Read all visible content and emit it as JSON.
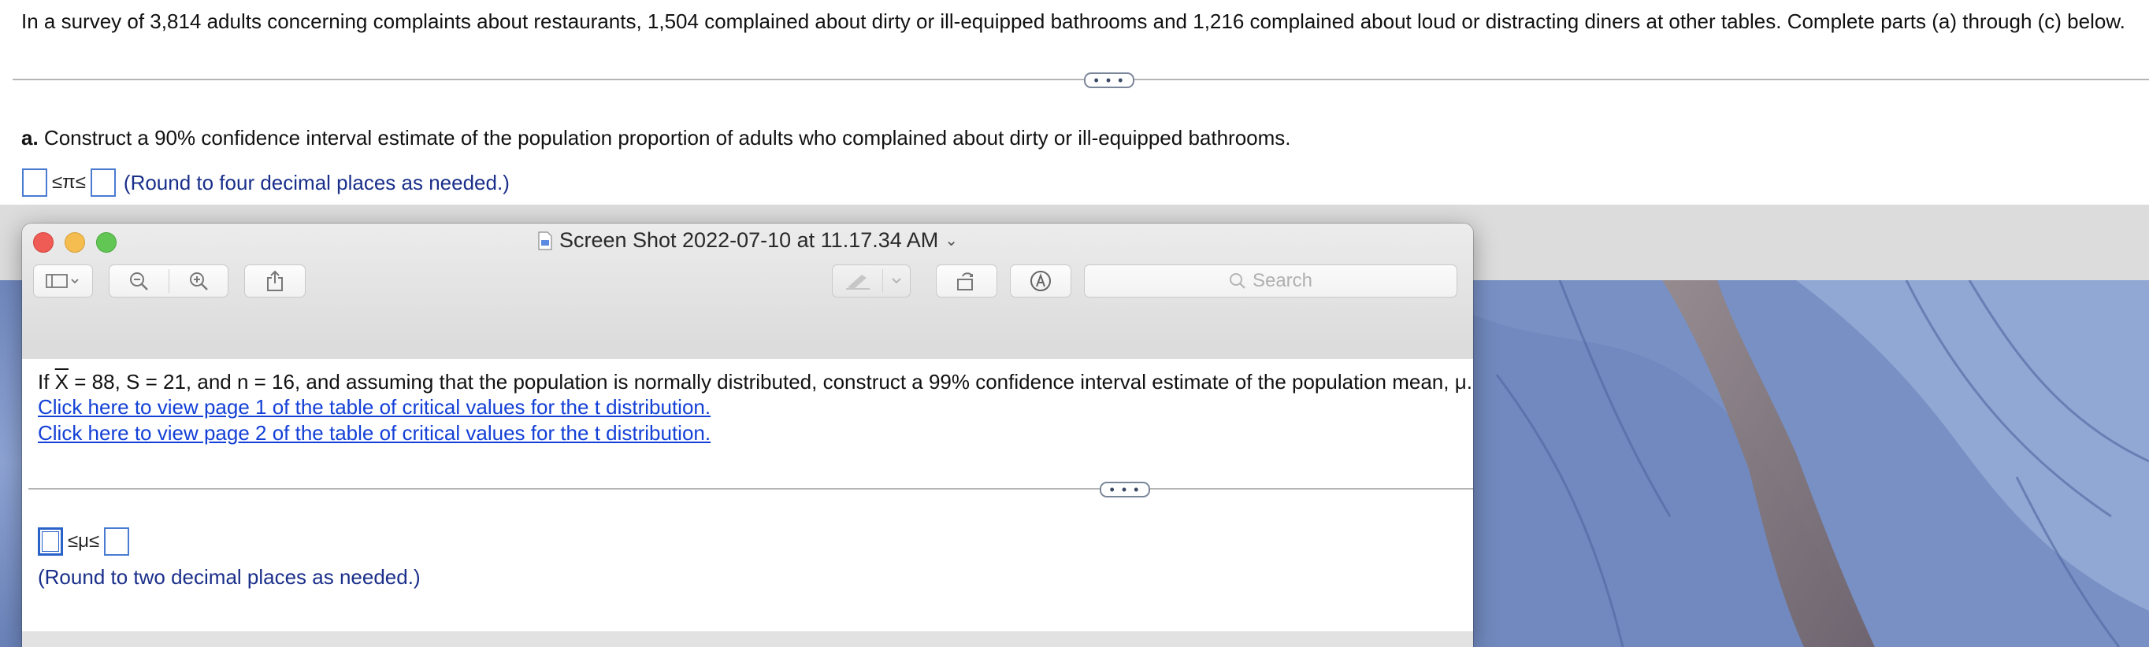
{
  "homework": {
    "intro": "In a survey of 3,814 adults concerning complaints about restaurants, 1,504 complained about dirty or ill-equipped bathrooms and 1,216 complained about loud or distracting diners at other tables. Complete parts (a) through (c) below.",
    "expand_dots": "• • •",
    "part_a_label": "a.",
    "part_a_text": " Construct a 90% confidence interval estimate of the population proportion of adults who complained about dirty or ill-equipped bathrooms.",
    "part_a_ineq": "≤π≤",
    "part_a_hint": "(Round to four decimal places as needed.)",
    "part_a_lower_value": "",
    "part_a_upper_value": ""
  },
  "preview_window": {
    "title": "Screen Shot 2022-07-10 at 11.17.34 AM",
    "title_chevron": "⌄",
    "search_placeholder": "Search",
    "toolbar_icons": [
      "sidebar-icon",
      "chevron-down-icon",
      "zoom-out-icon",
      "zoom-in-icon",
      "share-icon",
      "markup-pen-icon",
      "chevron-down-icon",
      "rotate-icon",
      "annotate-icon"
    ]
  },
  "question": {
    "text_prefix": "If ",
    "xbar_symbol": "X",
    "text_rest": " = 88, S = 21, and n = 16, and assuming that the population is normally distributed, construct a 99% confidence interval estimate of the population mean, μ.",
    "link1": "Click here to view page 1 of the table of critical values for the t distribution.",
    "link2": "Click here to view page 2 of the table of critical values for the t distribution.",
    "expand_dots": "• • •",
    "ineq": "≤μ≤",
    "hint": "(Round to two decimal places as needed.)",
    "lower_value": "",
    "upper_value": ""
  },
  "colors": {
    "link": "#1340d6",
    "hint": "#1a2f8a",
    "input_border": "#4a7bd1",
    "close": "#ee5c55",
    "minimize": "#f5bd4f",
    "zoom": "#62c655"
  }
}
